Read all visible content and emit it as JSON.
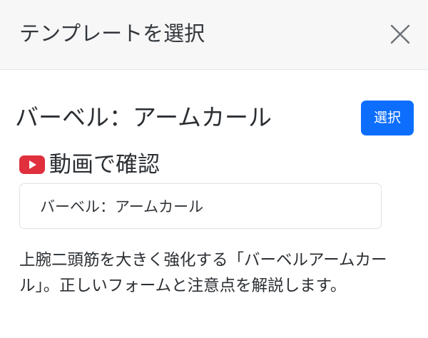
{
  "modal": {
    "title": "テンプレートを選択",
    "close_icon": "close-icon"
  },
  "template": {
    "title": "バーベル：アームカール",
    "select_label": "選択",
    "video_icon": "youtube-icon",
    "video_label": "動画で確認",
    "name_value": "バーベル：アームカール",
    "description": "上腕二頭筋を大きく強化する「バーベルアームカール」。正しいフォームと注意点を解説します。"
  },
  "colors": {
    "primary": "#0d6efd",
    "youtube_red": "#e02f3d",
    "header_bg": "#f7f7f8"
  }
}
